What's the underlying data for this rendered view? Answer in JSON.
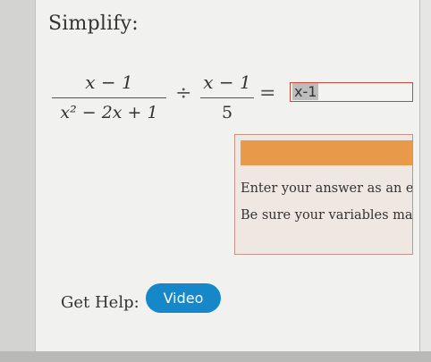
{
  "prompt": {
    "title": "Simplify:"
  },
  "expression": {
    "frac1": {
      "numerator": "x − 1",
      "denominator": "x² − 2x + 1"
    },
    "divide_symbol": "÷",
    "frac2": {
      "numerator": "x − 1",
      "denominator": "5"
    },
    "equals_symbol": "="
  },
  "answer": {
    "value": "x-1"
  },
  "hints": {
    "line1": "Enter your answer as an exp",
    "line2": "Be sure your variables matc"
  },
  "help": {
    "label": "Get Help:",
    "video_label": "Video"
  },
  "colors": {
    "accent": "#1687c8",
    "hint_orange": "#e89a4a",
    "error_border": "#c9473a"
  }
}
